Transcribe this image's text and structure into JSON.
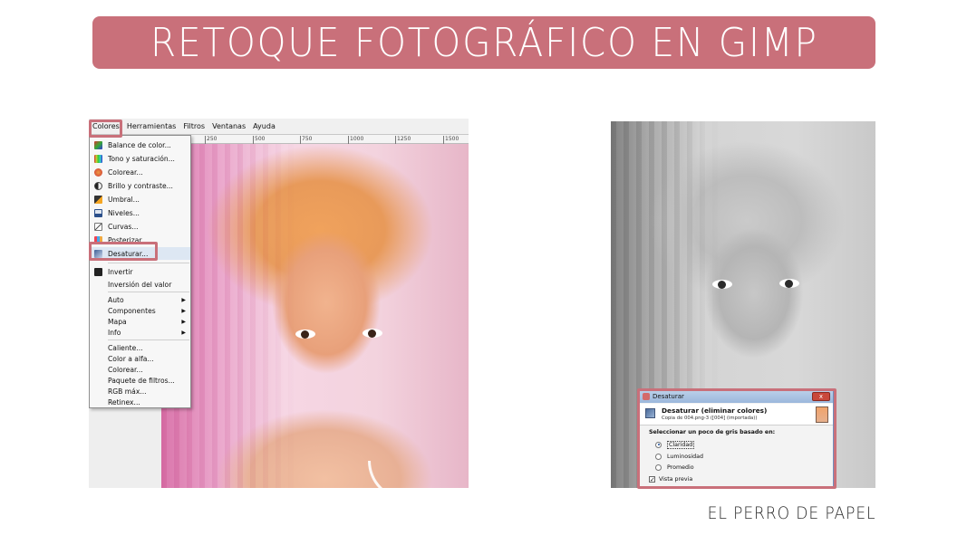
{
  "banner": {
    "title": "RETOQUE FOTOGRÁFICO EN GIMP",
    "color": "#c9707a"
  },
  "gimp": {
    "menubar": [
      "Colores",
      "Herramientas",
      "Filtros",
      "Ventanas",
      "Ayuda"
    ],
    "ruler_ticks": [
      "250",
      "500",
      "750",
      "1000",
      "1250",
      "1500"
    ],
    "colors_menu": {
      "items": [
        {
          "label": "Balance de color...",
          "icon": "balance-icon"
        },
        {
          "label": "Tono y saturación...",
          "icon": "hue-icon"
        },
        {
          "label": "Colorear...",
          "icon": "colorize-icon"
        },
        {
          "label": "Brillo y contraste...",
          "icon": "brightness-icon"
        },
        {
          "label": "Umbral...",
          "icon": "threshold-icon"
        },
        {
          "label": "Niveles...",
          "icon": "levels-icon"
        },
        {
          "label": "Curvas...",
          "icon": "curves-icon"
        },
        {
          "label": "Posterizar...",
          "icon": "posterize-icon"
        },
        {
          "label": "Desaturar...",
          "icon": "desaturate-icon"
        },
        {
          "label": "Invertir",
          "icon": "invert-icon"
        },
        {
          "label": "Inversión del valor",
          "icon": ""
        },
        {
          "label": "Auto",
          "submenu": true
        },
        {
          "label": "Componentes",
          "submenu": true
        },
        {
          "label": "Mapa",
          "submenu": true
        },
        {
          "label": "Info",
          "submenu": true
        },
        {
          "label": "Caliente..."
        },
        {
          "label": "Color a alfa..."
        },
        {
          "label": "Colorear..."
        },
        {
          "label": "Paquete de filtros..."
        },
        {
          "label": "RGB máx..."
        },
        {
          "label": "Retinex..."
        }
      ],
      "highlighted": "Desaturar..."
    }
  },
  "dialog": {
    "title": "Desaturar",
    "close": "x",
    "header_title": "Desaturar (eliminar colores)",
    "header_subtitle": "Copia de 004.png-3 ([004] (importada))",
    "section_label": "Seleccionar un poco de gris basado en:",
    "options": [
      "Claridad",
      "Luminosidad",
      "Promedio"
    ],
    "selected": "Claridad",
    "preview_label": "Vista previa",
    "preview_checked": true
  },
  "signature": "EL PERRO DE PAPEL",
  "accent_color": "#c9707a"
}
